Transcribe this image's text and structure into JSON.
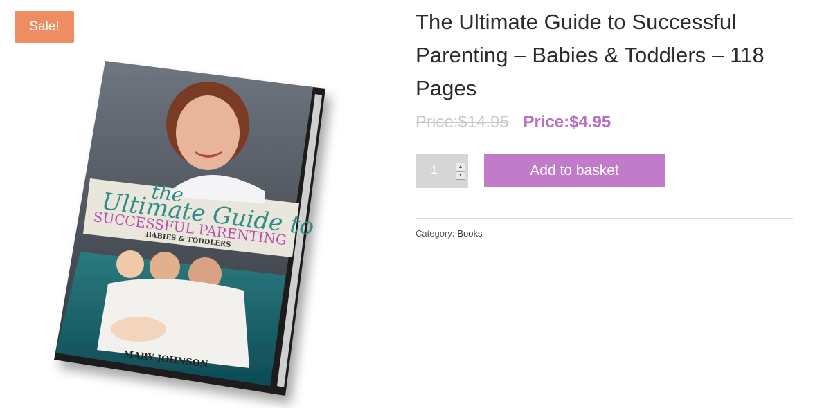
{
  "badge": {
    "sale_label": "Sale!"
  },
  "cover": {
    "line_1": "the",
    "line_2": "Ultimate Guide to",
    "line_3": "SUCCESSFUL PARENTING",
    "line_4": "BABIES & TODDLERS",
    "author": "MARY JOHNSON"
  },
  "product": {
    "title": "The Ultimate Guide to Successful Parenting – Babies & Toddlers – 118 Pages",
    "old_price": "Price:$14.95",
    "new_price": "Price:$4.95",
    "quantity_value": "1",
    "add_to_basket_label": "Add to basket",
    "category_label": "Category:",
    "category_value": "Books"
  },
  "colors": {
    "sale_badge": "#ef8c62",
    "price_accent": "#b86fc5",
    "button": "#c07cc9"
  }
}
